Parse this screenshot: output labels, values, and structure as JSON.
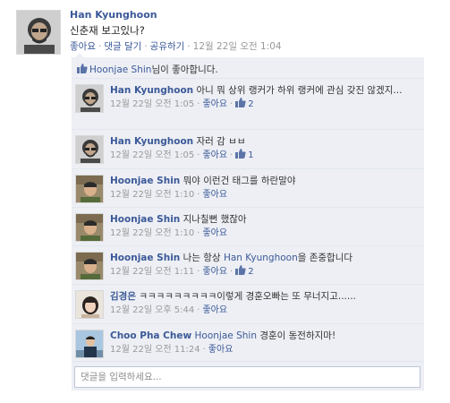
{
  "post": {
    "author": "Han Kyunghoon",
    "text": "신춘재 보고있나?",
    "actions": {
      "like": "좋아요",
      "comment": "댓글 달기",
      "share": "공유하기",
      "time": "12월 22일 오전 1:04"
    },
    "likes_name": "Hoonjae Shin",
    "likes_suffix": "님이 좋아합니다."
  },
  "comments": [
    {
      "author": "Han Kyunghoon",
      "text": "아니 뭐 상위 랭커가 하위 랭커에 관심 갖진 않겠지...",
      "time": "12월 22일 오전 1:05",
      "like": "좋아요",
      "like_count": "2"
    },
    {
      "author": "Han Kyunghoon",
      "text": "자러 감 ㅂㅂ",
      "time": "12월 22일 오전 1:05",
      "like": "좋아요",
      "like_count": "1"
    },
    {
      "author": "Hoonjae Shin",
      "text": "뭐야 이런건 태그를 하란말야",
      "time": "12월 22일 오전 1:10",
      "like": "좋아요"
    },
    {
      "author": "Hoonjae Shin",
      "text": "지나칠뻔 했잖아",
      "time": "12월 22일 오전 1:10",
      "like": "좋아요"
    },
    {
      "author": "Hoonjae Shin",
      "text_pre": "나는 항상 ",
      "mention": "Han Kyunghoon",
      "text_post": "을 존중합니다",
      "time": "12월 22일 오전 1:11",
      "like": "좋아요",
      "like_count": "2"
    },
    {
      "author": "김경은",
      "text": "ㅋㅋㅋㅋㅋㅋㅋㅋㅋ이렇게 경훈오빠는 또 무너지고......",
      "time": "12월 22일 오후 5:44",
      "like": "좋아요"
    },
    {
      "author": "Choo Pha Chew",
      "mention": "Hoonjae Shin",
      "text_post": " 경훈이 동전하지마!",
      "time": "12월 22일 오전 11:24",
      "like": "좋아요"
    }
  ],
  "comment_input": {
    "placeholder": "댓글을 입력하세요..."
  },
  "icons": {
    "like_thumb": "thumbs-up-icon"
  }
}
